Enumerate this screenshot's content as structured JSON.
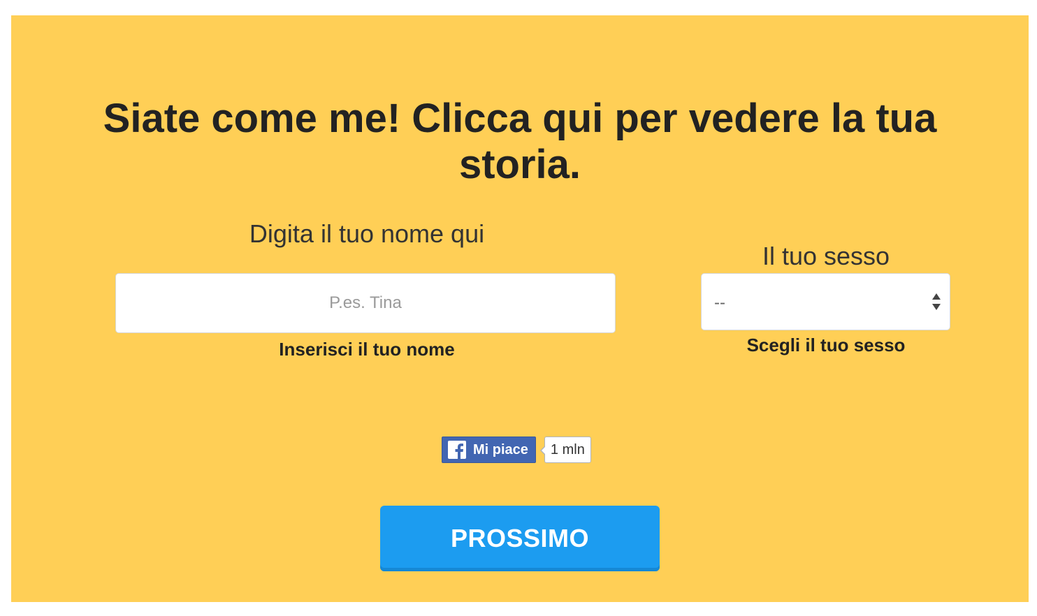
{
  "page": {
    "title": "Siate come me! Clicca qui per vedere la tua storia.",
    "background_color": "#ffcf56"
  },
  "form": {
    "name": {
      "label": "Digita il tuo nome qui",
      "placeholder": "P.es. Tina",
      "value": "",
      "hint": "Inserisci il tuo nome"
    },
    "sex": {
      "label": "Il tuo sesso",
      "selected": "--",
      "hint": "Scegli il tuo sesso",
      "arrow_icon": "up-down-arrows-icon"
    }
  },
  "facebook_like": {
    "icon": "facebook-f-icon",
    "label": "Mi piace",
    "count": "1 mln",
    "color": "#4266b2"
  },
  "next_button": {
    "label": "PROSSIMO",
    "color": "#1c9cf0"
  }
}
